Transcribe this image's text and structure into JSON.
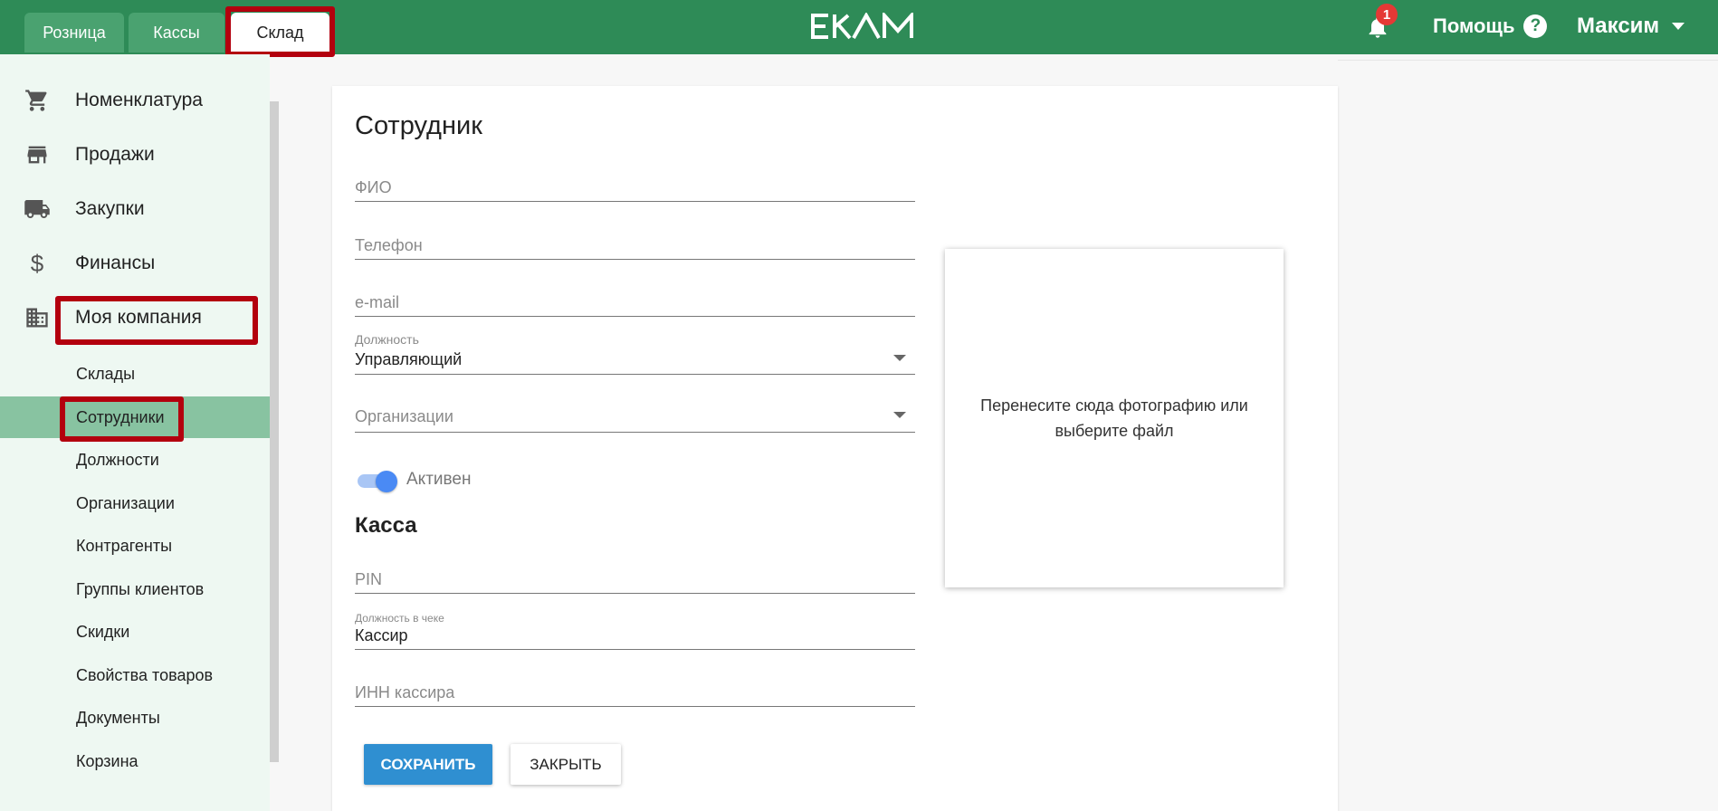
{
  "header": {
    "tabs": [
      {
        "label": "Розница"
      },
      {
        "label": "Кассы"
      },
      {
        "label": "Склад"
      }
    ],
    "logo": "EKAM",
    "notifications_count": "1",
    "help_label": "Помощь",
    "help_glyph": "?",
    "user_name": "Максим"
  },
  "sidebar": {
    "items": [
      {
        "label": "Номенклатура",
        "icon": "cart-icon"
      },
      {
        "label": "Продажи",
        "icon": "store-icon"
      },
      {
        "label": "Закупки",
        "icon": "truck-icon"
      },
      {
        "label": "Финансы",
        "icon": "dollar-icon"
      },
      {
        "label": "Моя компания",
        "icon": "building-icon"
      }
    ],
    "subitems": [
      {
        "label": "Склады"
      },
      {
        "label": "Сотрудники"
      },
      {
        "label": "Должности"
      },
      {
        "label": "Организации"
      },
      {
        "label": "Контрагенты"
      },
      {
        "label": "Группы клиентов"
      },
      {
        "label": "Скидки"
      },
      {
        "label": "Свойства товаров"
      },
      {
        "label": "Документы"
      },
      {
        "label": "Корзина"
      }
    ],
    "dollar_glyph": "$"
  },
  "form": {
    "title": "Сотрудник",
    "fio_placeholder": "ФИО",
    "phone_placeholder": "Телефон",
    "email_placeholder": "e-mail",
    "position_label": "Должность",
    "position_value": "Управляющий",
    "organizations_placeholder": "Организации",
    "active_label": "Активен",
    "cash_section_title": "Касса",
    "pin_placeholder": "PIN",
    "receipt_position_label": "Должность в чеке",
    "receipt_position_value": "Кассир",
    "inn_placeholder": "ИНН кассира",
    "save_label": "СОХРАНИТЬ",
    "close_label": "ЗАКРЫТЬ",
    "dropzone_text": "Перенесите сюда фотографию или выберите файл"
  },
  "colors": {
    "header_green": "#2e8b57",
    "highlight_red": "#b3000e",
    "sidebar_selected": "#88c3a1",
    "save_blue": "#2f8fd1",
    "toggle_blue": "#4a8af4"
  }
}
